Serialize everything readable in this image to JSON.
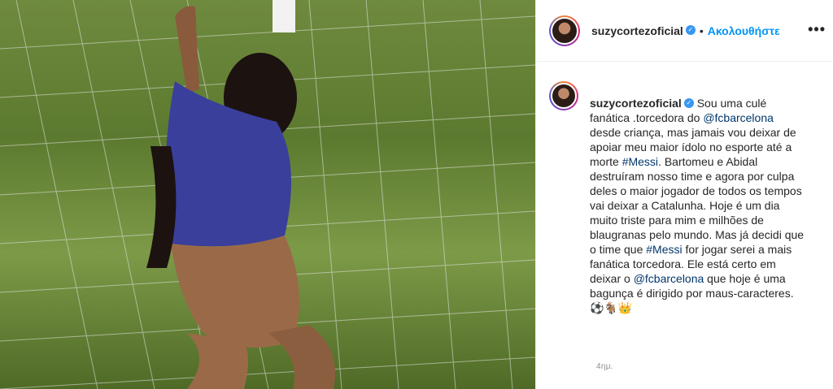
{
  "post": {
    "photo_icon": "post-photo",
    "username": "suzycortezoficial",
    "verified_icon": "verified-badge-icon",
    "separator": "•",
    "follow_label": "Ακολουθήστε",
    "more_icon": "more-options-icon",
    "more_label": "•••"
  },
  "caption": {
    "username": "suzycortezoficial",
    "parts": [
      {
        "text": " Sou uma culé fanática .torcedora do "
      },
      {
        "text": "@fcbarcelona",
        "link": true
      },
      {
        "text": " desde criança, mas jamais vou deixar de apoiar meu maior ídolo no esporte até a morte "
      },
      {
        "text": "#Messi",
        "link": true
      },
      {
        "text": ". Bartomeu e Abidal destruíram nosso time e agora por culpa deles o maior jogador de todos os tempos vai deixar a Catalunha. Hoje é um dia muito triste para mim e milhões de blaugranas pelo mundo. Mas já decidi que o time que "
      },
      {
        "text": "#Messi",
        "link": true
      },
      {
        "text": " for jogar serei a mais fanática torcedora. Ele está certo em deixar o "
      },
      {
        "text": "@fcbarcelona",
        "link": true
      },
      {
        "text": " que hoje é uma bagunça é dirigido por maus-caracteres. ⚽🐐👑"
      }
    ],
    "time": "4ημ."
  }
}
